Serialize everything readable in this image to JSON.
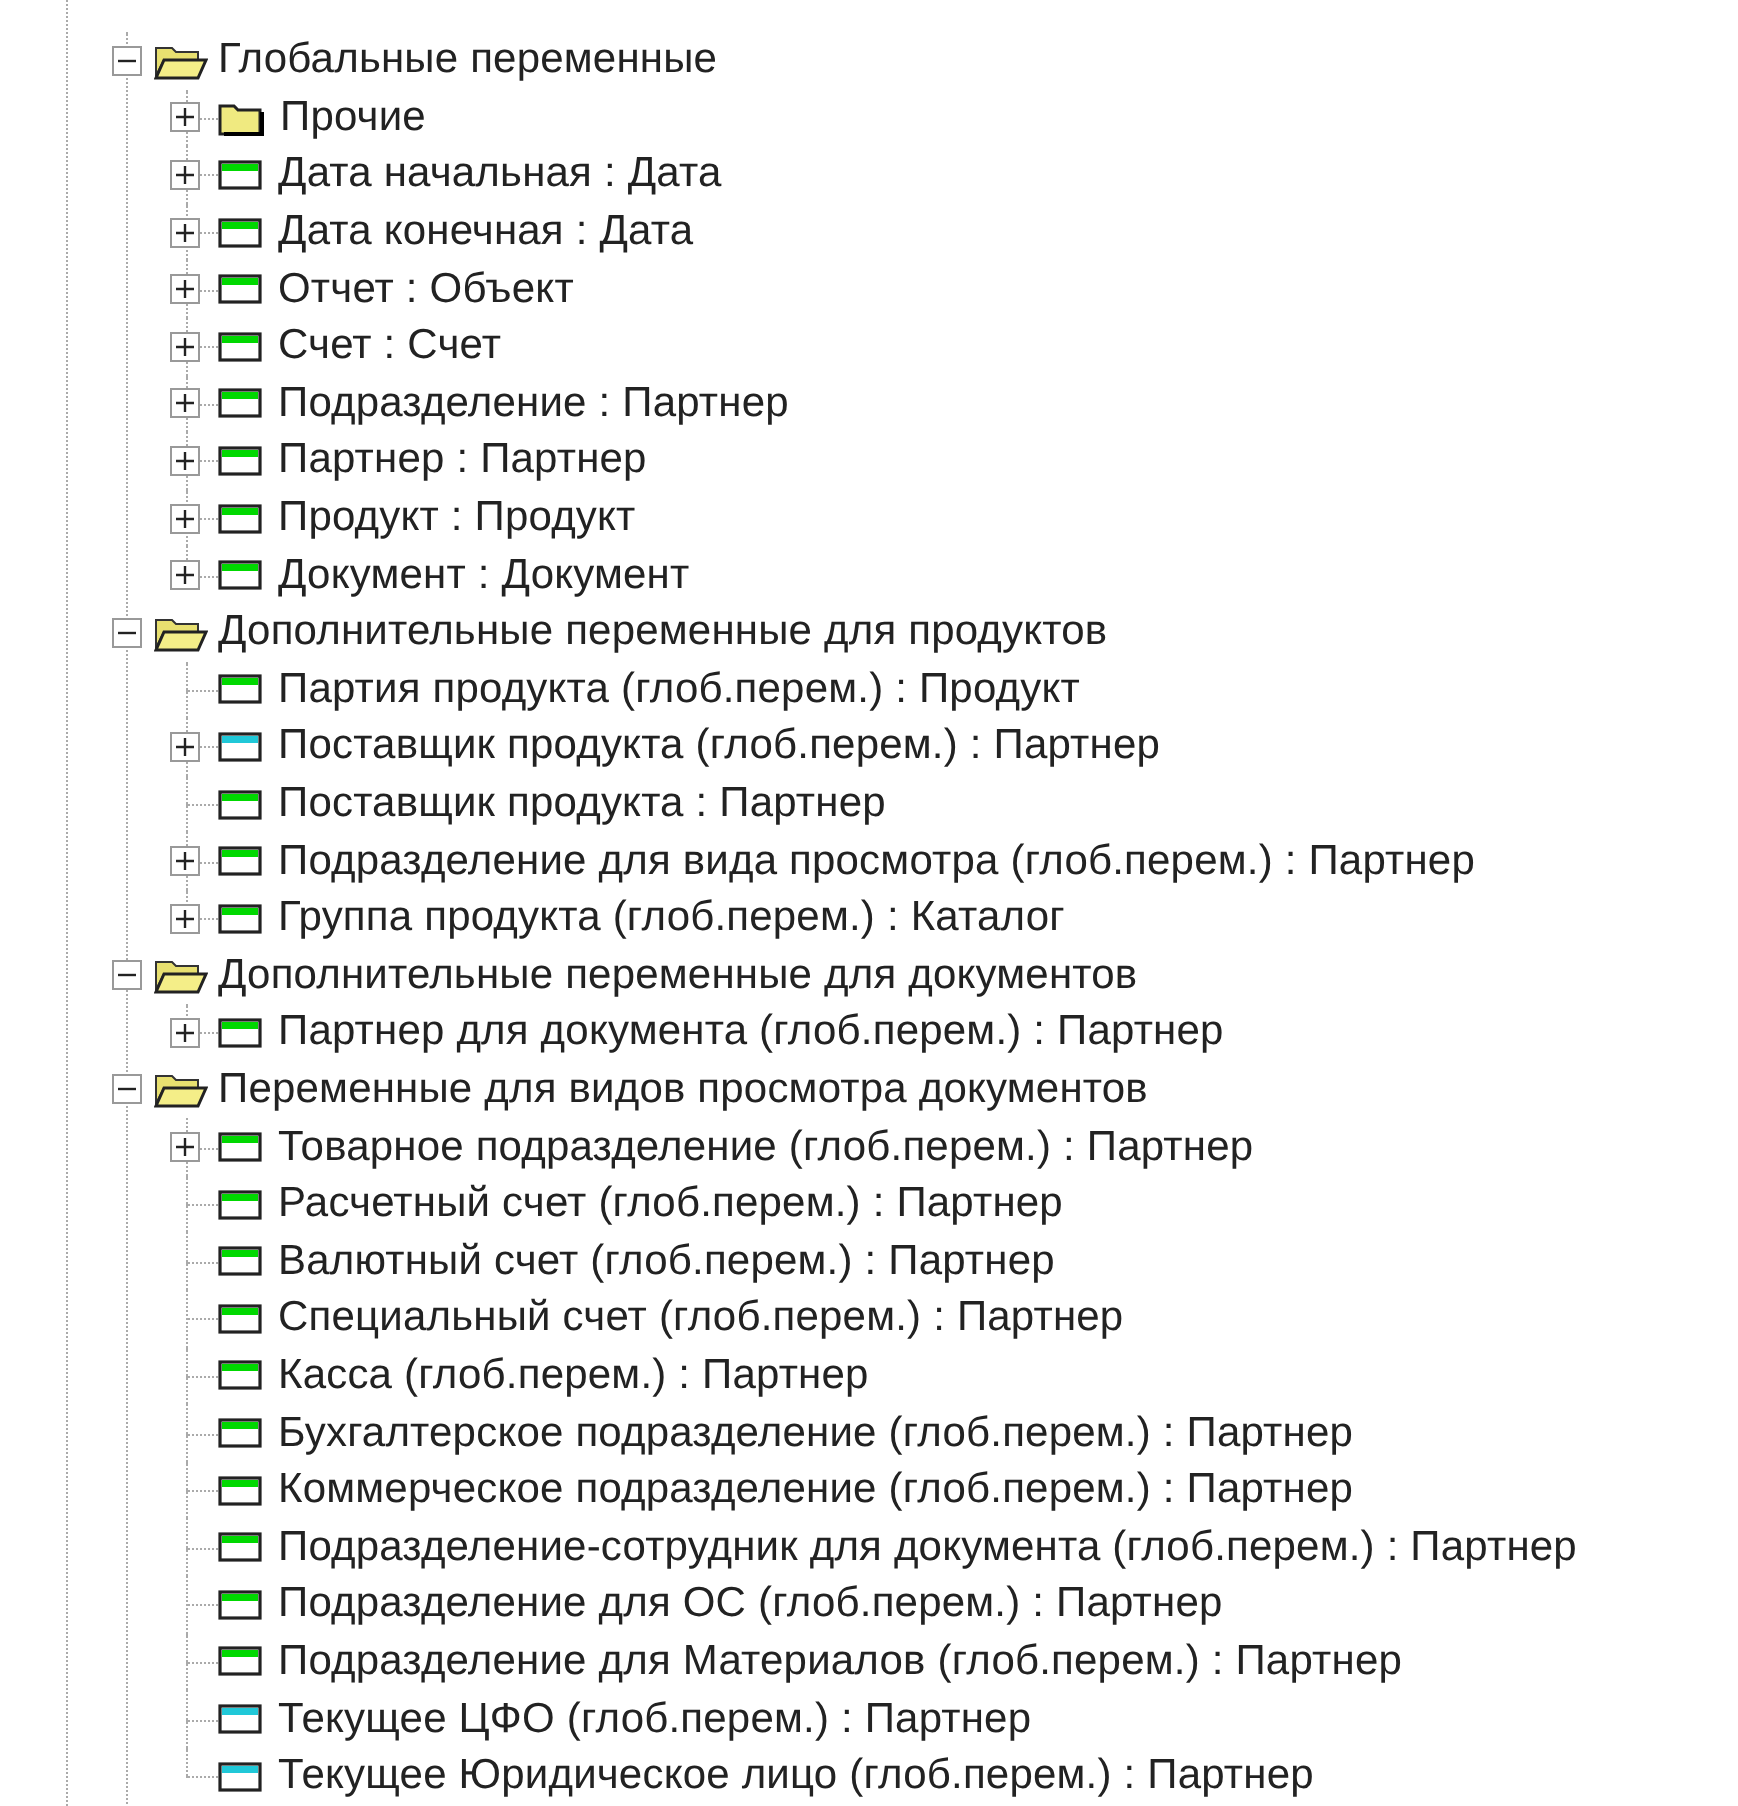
{
  "tree": [
    {
      "label": "Глобальные переменные",
      "kind": "folder",
      "expanded": true,
      "children": [
        {
          "label": "Прочие",
          "kind": "folder",
          "expandable": true
        },
        {
          "label": "Дата начальная : Дата",
          "kind": "variable",
          "color": "#00d800",
          "expandable": true
        },
        {
          "label": "Дата конечная : Дата",
          "kind": "variable",
          "color": "#00d800",
          "expandable": true
        },
        {
          "label": "Отчет : Объект",
          "kind": "variable",
          "color": "#00d800",
          "expandable": true
        },
        {
          "label": "Счет : Счет",
          "kind": "variable",
          "color": "#00d800",
          "expandable": true
        },
        {
          "label": "Подразделение : Партнер",
          "kind": "variable",
          "color": "#00d800",
          "expandable": true
        },
        {
          "label": "Партнер : Партнер",
          "kind": "variable",
          "color": "#00d800",
          "expandable": true
        },
        {
          "label": "Продукт : Продукт",
          "kind": "variable",
          "color": "#00d800",
          "expandable": true
        },
        {
          "label": "Документ : Документ",
          "kind": "variable",
          "color": "#00d800",
          "expandable": true
        }
      ]
    },
    {
      "label": "Дополнительные переменные для продуктов",
      "kind": "folder",
      "expanded": true,
      "children": [
        {
          "label": "Партия продукта (глоб.перем.) : Продукт",
          "kind": "variable",
          "color": "#00d800",
          "expandable": false
        },
        {
          "label": "Поставщик продукта (глоб.перем.) : Партнер",
          "kind": "variable",
          "color": "#20c8d8",
          "expandable": true
        },
        {
          "label": "Поставщик продукта : Партнер",
          "kind": "variable",
          "color": "#00d800",
          "expandable": false
        },
        {
          "label": "Подразделение для вида просмотра (глоб.перем.) : Партнер",
          "kind": "variable",
          "color": "#00d800",
          "expandable": true
        },
        {
          "label": "Группа продукта (глоб.перем.) : Каталог",
          "kind": "variable",
          "color": "#00d800",
          "expandable": true
        }
      ]
    },
    {
      "label": "Дополнительные переменные для документов",
      "kind": "folder",
      "expanded": true,
      "children": [
        {
          "label": "Партнер для документа (глоб.перем.) : Партнер",
          "kind": "variable",
          "color": "#00d800",
          "expandable": true
        }
      ]
    },
    {
      "label": "Переменные для видов просмотра документов",
      "kind": "folder",
      "expanded": true,
      "children": [
        {
          "label": "Товарное подразделение (глоб.перем.) : Партнер",
          "kind": "variable",
          "color": "#00d800",
          "expandable": true
        },
        {
          "label": "Расчетный счет (глоб.перем.) : Партнер",
          "kind": "variable",
          "color": "#00d800",
          "expandable": false
        },
        {
          "label": "Валютный счет (глоб.перем.) : Партнер",
          "kind": "variable",
          "color": "#00d800",
          "expandable": false
        },
        {
          "label": "Специальный счет (глоб.перем.) : Партнер",
          "kind": "variable",
          "color": "#00d800",
          "expandable": false
        },
        {
          "label": "Касса (глоб.перем.) : Партнер",
          "kind": "variable",
          "color": "#00d800",
          "expandable": false
        },
        {
          "label": "Бухгалтерское подразделение (глоб.перем.) : Партнер",
          "kind": "variable",
          "color": "#00d800",
          "expandable": false
        },
        {
          "label": "Коммерческое подразделение (глоб.перем.) : Партнер",
          "kind": "variable",
          "color": "#00d800",
          "expandable": false
        },
        {
          "label": "Подразделение-сотрудник для документа (глоб.перем.) : Партнер",
          "kind": "variable",
          "color": "#00d800",
          "expandable": false
        },
        {
          "label": "Подразделение для ОС (глоб.перем.) : Партнер",
          "kind": "variable",
          "color": "#00d800",
          "expandable": false
        },
        {
          "label": "Подразделение для Материалов (глоб.перем.) : Партнер",
          "kind": "variable",
          "color": "#00d800",
          "expandable": false
        },
        {
          "label": "Текущее ЦФО (глоб.перем.) : Партнер",
          "kind": "variable",
          "color": "#20c8d8",
          "expandable": false
        },
        {
          "label": "Текущее Юридическое лицо (глоб.перем.) : Партнер",
          "kind": "variable",
          "color": "#20c8d8",
          "expandable": false
        }
      ]
    }
  ]
}
